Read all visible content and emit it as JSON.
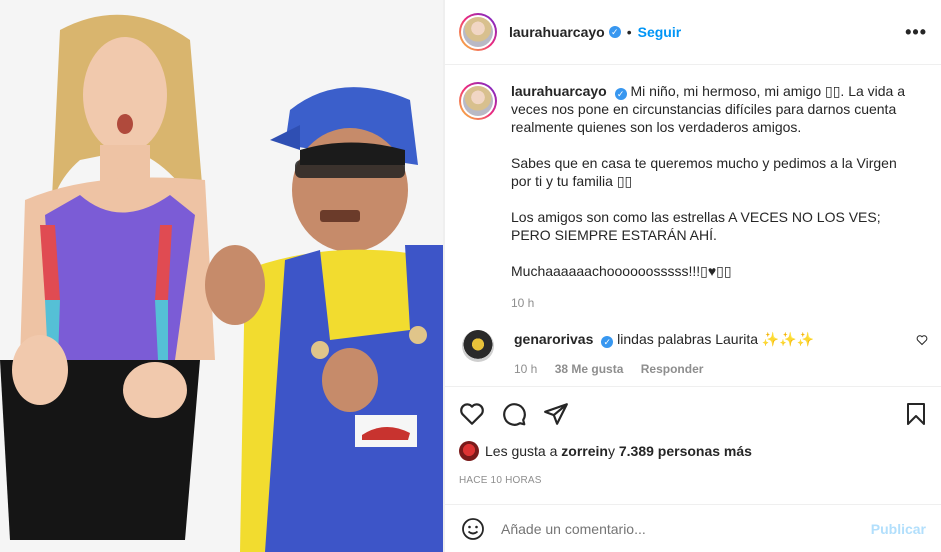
{
  "post": {
    "image_alt": "photo"
  },
  "header": {
    "username": "laurahuarcayo",
    "separator": "•",
    "follow_label": "Seguir",
    "more_label": "•••"
  },
  "caption": {
    "username": "laurahuarcayo",
    "paragraphs": [
      "Mi niño, mi hermoso, mi amigo ▯▯. La vida a veces nos pone en circunstancias difíciles para darnos cuenta realmente quienes son los verdaderos amigos.",
      "Sabes que en casa te queremos mucho y pedimos a la Virgen por ti y tu familia ▯▯",
      "Los amigos son como las estrellas A VECES NO LOS VES; PERO SIEMPRE ESTARÁN AHÍ.",
      "Muchaaaaaachoooooosssss!!!▯♥▯▯"
    ],
    "time": "10 h"
  },
  "comment": {
    "username": "genarorivas",
    "text": "lindas palabras Laurita ✨✨✨",
    "time": "10 h",
    "likes": "38 Me gusta",
    "reply": "Responder"
  },
  "likes": {
    "prefix": "Les gusta a ",
    "user": "zorrein",
    "middle": " y ",
    "count": "7.389 personas más"
  },
  "timestamp": "HACE 10 HORAS",
  "add_comment": {
    "placeholder": "Añade un comentario...",
    "publish_label": "Publicar"
  },
  "colors": {
    "accent": "#0095f6",
    "publish_disabled": "#b2dffc",
    "verified": "#3897f0"
  }
}
